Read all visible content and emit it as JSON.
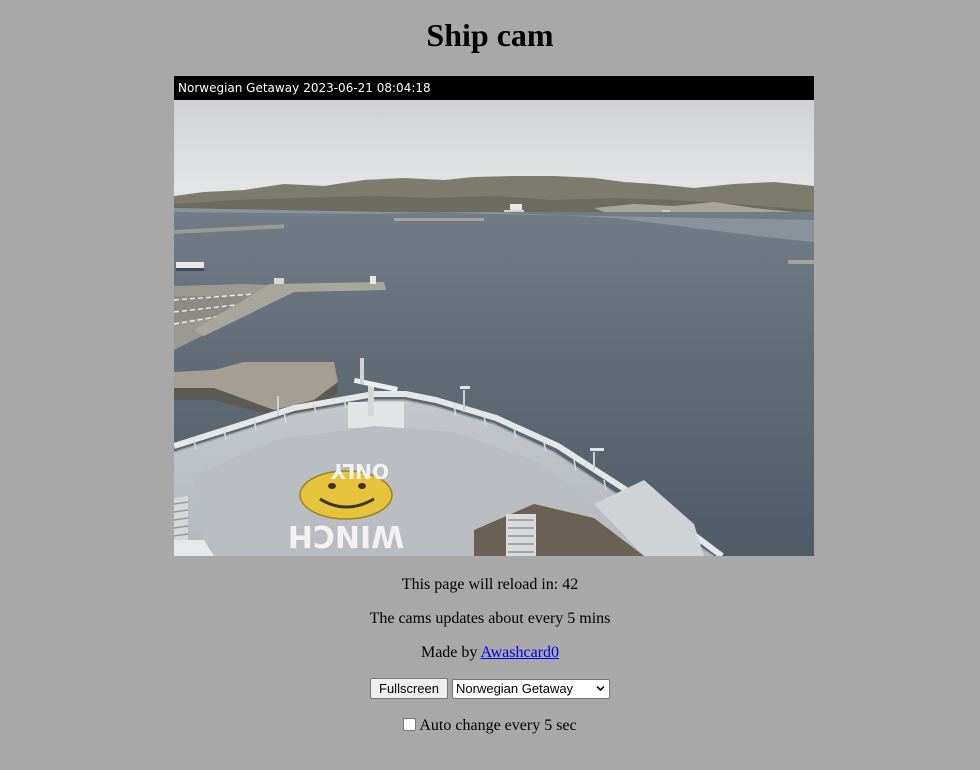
{
  "page": {
    "title": "Ship cam"
  },
  "cam": {
    "overlay_ship": "Norwegian Getaway",
    "overlay_timestamp": "2023-06-21 08:04:18",
    "deck_text_top": "ONLY",
    "deck_text_bottom": "WINCH"
  },
  "status": {
    "reload_text": "This page will reload in: 42",
    "update_text": "The cams updates about every 5 mins",
    "made_by_prefix": "Made by ",
    "made_by_link": "Awashcard0"
  },
  "controls": {
    "fullscreen_label": "Fullscreen",
    "ship_select_value": "Norwegian Getaway",
    "auto_change_label": "Auto change every 5 sec",
    "auto_change_checked": false
  },
  "colors": {
    "page_background": "#a8a8a8",
    "link": "#0000ee",
    "overlay_background": "#000000",
    "overlay_text": "#ffffff"
  }
}
